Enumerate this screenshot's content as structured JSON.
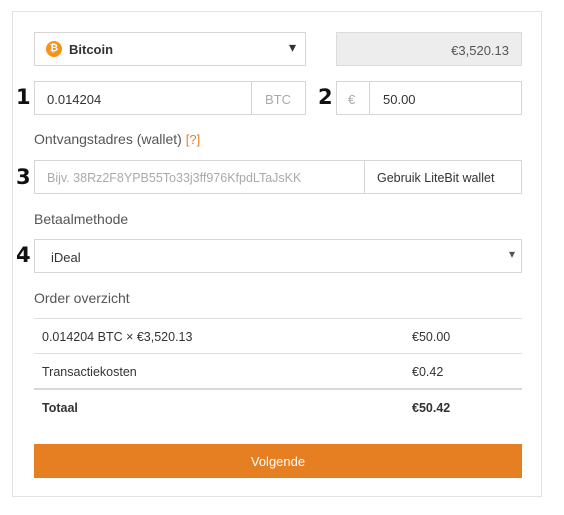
{
  "coin_select": {
    "icon": "bitcoin-icon",
    "icon_glyph": "₿",
    "icon_color": "#f7931a",
    "label": "Bitcoin",
    "caret": "▾"
  },
  "price_display": {
    "value": "€3,520.13"
  },
  "steps": {
    "one": "1",
    "two": "2",
    "three": "3",
    "four": "4"
  },
  "amount": {
    "value": "0.014204",
    "unit": "BTC"
  },
  "fiat": {
    "symbol": "€",
    "value": "50.00"
  },
  "wallet": {
    "label": "Ontvangstadres (wallet)",
    "help": "[?]",
    "placeholder": "Bijv. 38Rz2F8YPB55To33j3ff976KfpdLTaJsKK",
    "button": "Gebruik LiteBit wallet"
  },
  "payment": {
    "label": "Betaalmethode",
    "selected": "iDeal",
    "caret": "▾"
  },
  "order": {
    "title": "Order overzicht",
    "rows": [
      {
        "desc": "0.014204 BTC × €3,520.13",
        "amount": "€50.00"
      },
      {
        "desc": "Transactiekosten",
        "amount": "€0.42"
      },
      {
        "desc": "Totaal",
        "amount": "€50.42"
      }
    ]
  },
  "next_button": {
    "label": "Volgende",
    "color": "#e67e22"
  }
}
